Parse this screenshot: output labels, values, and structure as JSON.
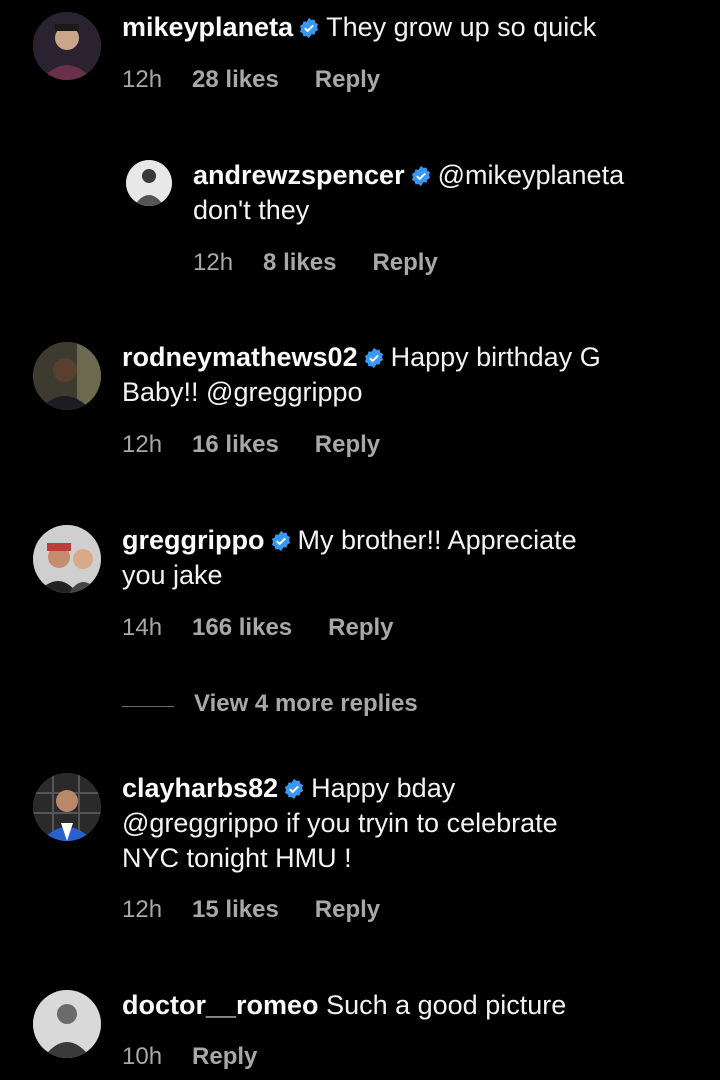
{
  "comments": [
    {
      "username": "mikeyplaneta",
      "verified": true,
      "text": "They grow up so quick",
      "time": "12h",
      "likes": "28 likes",
      "reply_label": "Reply"
    },
    {
      "username": "andrewzspencer",
      "verified": true,
      "mention": "@mikeyplaneta",
      "text": "don't they",
      "time": "12h",
      "likes": "8 likes",
      "reply_label": "Reply"
    },
    {
      "username": "rodneymathews02",
      "verified": true,
      "text": "Happy birthday G Baby!! @greggrippo",
      "text_line1": "Happy birthday G",
      "text_line2": "Baby!! @greggrippo",
      "time": "12h",
      "likes": "16 likes",
      "reply_label": "Reply"
    },
    {
      "username": "greggrippo",
      "verified": true,
      "text_line1": "My brother!! Appreciate",
      "text_line2": "you jake",
      "time": "14h",
      "likes": "166 likes",
      "reply_label": "Reply"
    },
    {
      "username": "clayharbs82",
      "verified": true,
      "text_line1": "Happy bday",
      "text_line2": "@greggrippo if you tryin to celebrate",
      "text_line3": "NYC tonight HMU !",
      "time": "12h",
      "likes": "15 likes",
      "reply_label": "Reply"
    },
    {
      "username": "doctor__romeo",
      "verified": false,
      "text": "Such a good picture",
      "time": "10h",
      "reply_label": "Reply"
    }
  ],
  "view_more_replies": "View 4 more replies",
  "colors": {
    "background": "#000000",
    "verified_badge": "#3897f0",
    "meta_text": "#a8a8a8"
  }
}
